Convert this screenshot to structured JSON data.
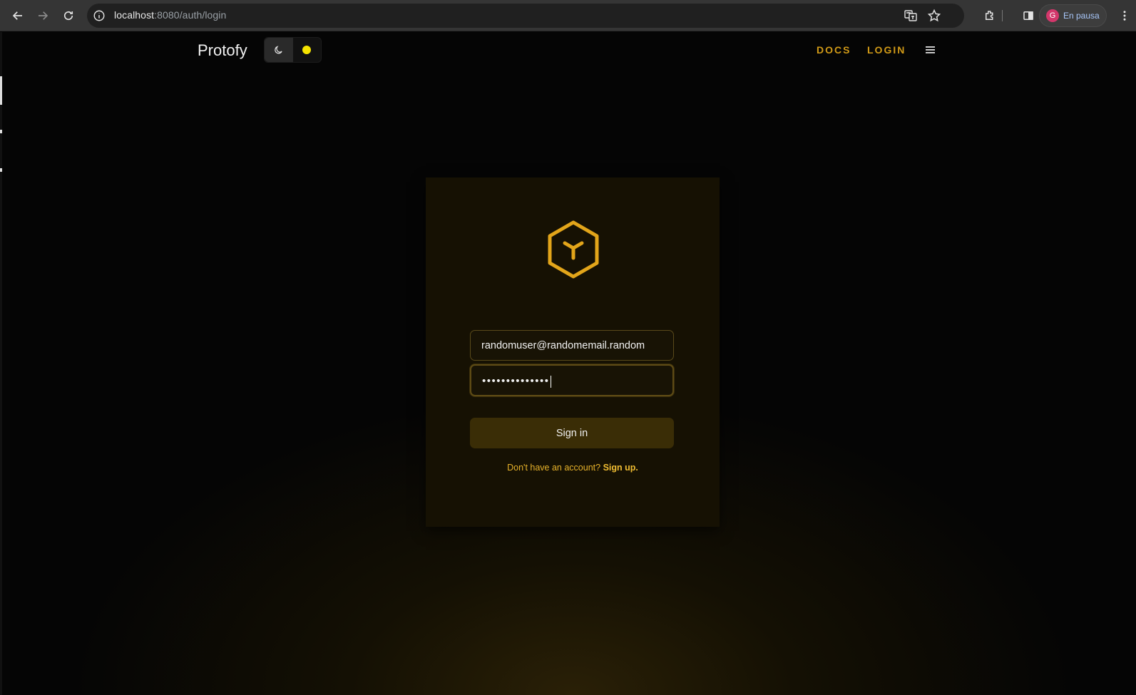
{
  "browser": {
    "url_host": "localhost",
    "url_path": ":8080/auth/login",
    "profile_initial": "G",
    "profile_status": "En pausa"
  },
  "header": {
    "brand": "Protofy",
    "nav_links": [
      "DOCS",
      "LOGIN"
    ]
  },
  "login": {
    "email_value": "randomuser@randomemail.random",
    "password_masked": "••••••••••••••",
    "signin_label": "Sign in",
    "signup_prompt": "Don't have an account?",
    "signup_link": "Sign up."
  },
  "colors": {
    "accent": "#d19a17",
    "card_bg": "#161103",
    "button_bg": "#3a2d06",
    "page_bg": "#050505"
  },
  "icons": [
    "back-arrow-icon",
    "forward-arrow-icon",
    "reload-icon",
    "site-info-icon",
    "translate-icon",
    "star-icon",
    "extensions-icon",
    "side-panel-icon",
    "more-vert-icon",
    "moon-icon",
    "menu-icon",
    "protofy-logo-icon"
  ]
}
